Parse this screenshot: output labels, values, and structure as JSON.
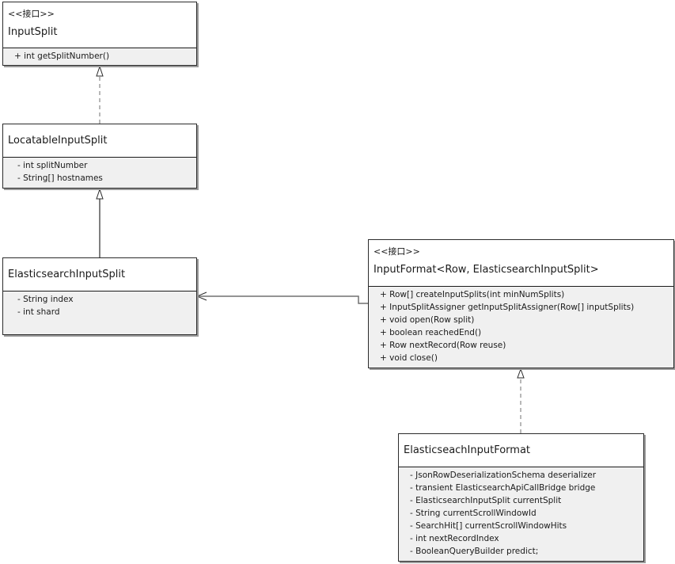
{
  "diagram": {
    "type": "uml-class-diagram",
    "classes": [
      {
        "id": "input-split",
        "stereotype": "<<接口>>",
        "name": "InputSplit",
        "members": [
          "+ int getSplitNumber()"
        ]
      },
      {
        "id": "locatable-input-split",
        "stereotype": "",
        "name": "LocatableInputSplit",
        "members": [
          "- int splitNumber",
          "- String[] hostnames"
        ]
      },
      {
        "id": "elasticsearch-input-split",
        "stereotype": "",
        "name": "ElasticsearchInputSplit",
        "members": [
          "- String index",
          "- int shard"
        ]
      },
      {
        "id": "input-format",
        "stereotype": "<<接口>>",
        "name": "InputFormat<Row, ElasticsearchInputSplit>",
        "members": [
          "+ Row[] createInputSplits(int minNumSplits)",
          "+ InputSplitAssigner getInputSplitAssigner(Row[] inputSplits)",
          "+ void open(Row split)",
          "+ boolean reachedEnd()",
          "+ Row nextRecord(Row reuse)",
          "+ void close()"
        ]
      },
      {
        "id": "elasticseach-input-format",
        "stereotype": "",
        "name": "ElasticseachInputFormat",
        "members": [
          "- JsonRowDeserializationSchema deserializer",
          "- transient ElasticsearchApiCallBridge bridge",
          "- ElasticsearchInputSplit currentSplit",
          "- String currentScrollWindowId",
          "- SearchHit[] currentScrollWindowHits",
          "- int nextRecordIndex",
          "- BooleanQueryBuilder predict;"
        ]
      }
    ],
    "relations": [
      {
        "from": "locatable-input-split",
        "to": "input-split",
        "kind": "realization"
      },
      {
        "from": "elasticsearch-input-split",
        "to": "locatable-input-split",
        "kind": "generalization"
      },
      {
        "from": "elasticseach-input-format",
        "to": "input-format",
        "kind": "realization"
      },
      {
        "from": "input-format",
        "to": "elasticsearch-input-split",
        "kind": "association"
      }
    ],
    "colors": {
      "border": "#2b2b2b",
      "compartment_fill": "#f0f0f0",
      "header_fill": "#ffffff",
      "line": "#707070"
    }
  }
}
